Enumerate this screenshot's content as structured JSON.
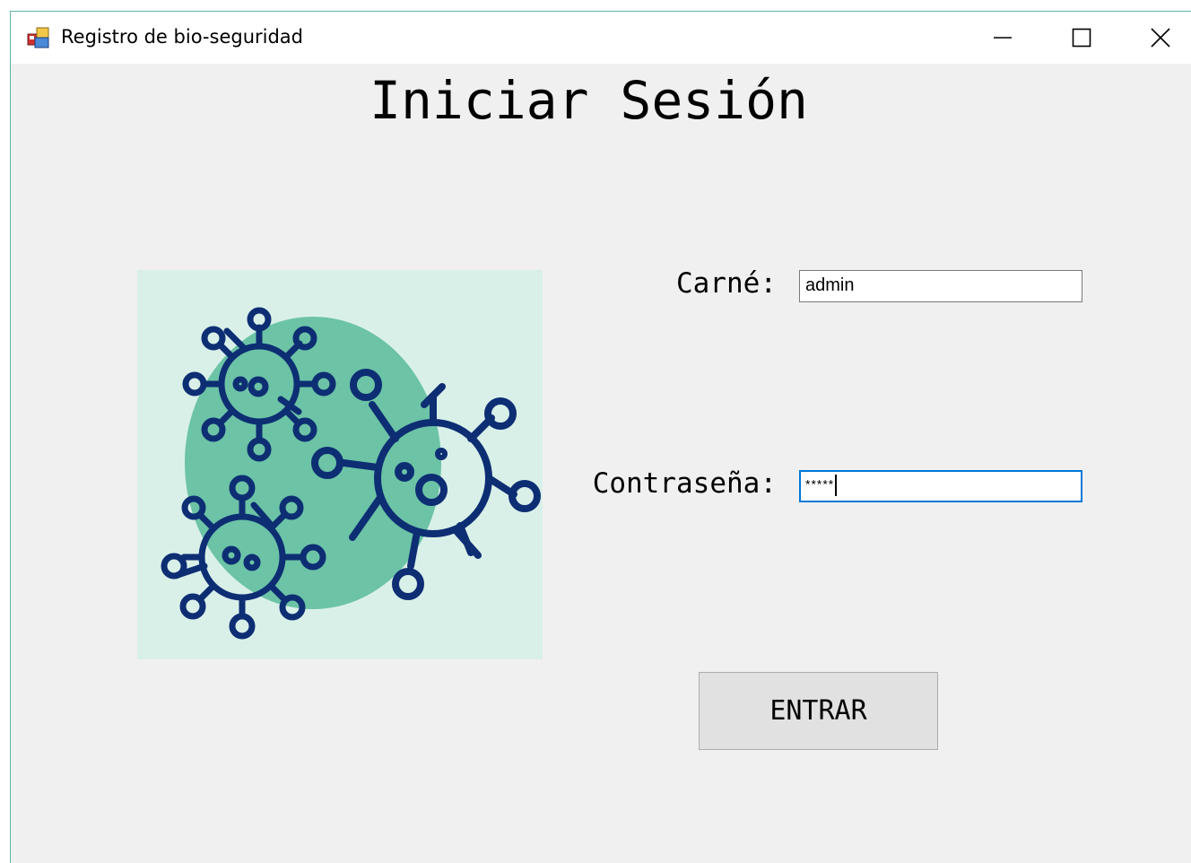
{
  "window": {
    "title": "Registro de bio-seguridad",
    "icon": "windows-form-icon",
    "controls": [
      "minimize-icon",
      "maximize-icon",
      "close-icon"
    ]
  },
  "form": {
    "heading": "Iniciar Sesión",
    "carne_label": "Carné:",
    "carne_value": "admin",
    "password_label": "Contraseña:",
    "password_value": "*****",
    "submit_label": "ENTRAR"
  },
  "illustration": {
    "name": "virus-illustration",
    "colors": {
      "background": "#d9f0e9",
      "blob": "#6cc3a6",
      "stroke": "#0d2e73"
    }
  },
  "colors": {
    "window_bg": "#f0f0f0",
    "button_bg": "#e1e1e1",
    "focus_border": "#0078d7"
  }
}
